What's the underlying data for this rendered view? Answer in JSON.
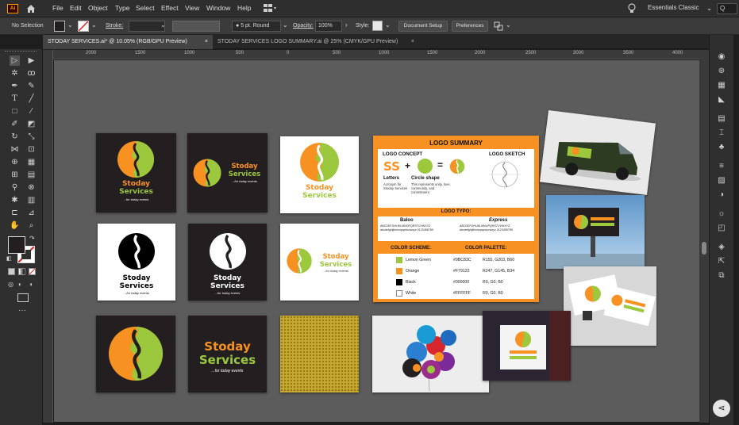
{
  "app": {
    "logo": "Ai",
    "workspace": "Essentials Classic",
    "search_hint": "Q"
  },
  "menu": [
    "File",
    "Edit",
    "Object",
    "Type",
    "Select",
    "Effect",
    "View",
    "Window",
    "Help"
  ],
  "control": {
    "selection": "No Selection",
    "stroke_label": "Stroke:",
    "brush": "5 pt. Round",
    "opacity_label": "Opacity:",
    "opacity_value": "100%",
    "style_label": "Style:",
    "document_setup": "Document Setup",
    "preferences": "Preferences"
  },
  "tabs": [
    {
      "label": "STODAY SERVICES.ai* @ 10.05% (RGB/GPU Preview)",
      "active": true,
      "close": "×"
    },
    {
      "label": "STODAY SERVICES LOGO SUMMARY.ai @ 25% (CMYK/GPU Preview)",
      "active": false,
      "close": "×"
    }
  ],
  "ruler": [
    "2000",
    "1500",
    "1000",
    "500",
    "0",
    "500",
    "1000",
    "1500",
    "2000",
    "2500",
    "3000",
    "3500",
    "4000"
  ],
  "colors": {
    "green": "#9BC83C",
    "orange": "#F79122",
    "black": "#231F20"
  },
  "logo": {
    "line1": "Stoday",
    "line2": "Services",
    "tagline": "...for today events"
  },
  "summary": {
    "title": "LOGO SUMMARY",
    "concept": "LOGO CONCEPT",
    "sketch": "LOGO SKETCH",
    "letters": "SS",
    "plus": "+",
    "equals": "=",
    "letters_label": "Letters",
    "letters_desc": "Acronym for Stoday Services",
    "circle_label": "Circle shape",
    "circle_desc": "This represents unity, love, community, and commitment",
    "typo": "LOGO TYPO:",
    "font1": "Baloo",
    "font2": "Express",
    "font1_sample": "ABCDEFGHIJKLMNOPQRSTUVWXYZ abcdefghijklmnopqrstuvwxyz 0123456789",
    "font2_sample": "ABCDEFGHIJKLMNOPQRSTUVWXYZ abcdefghijklmnopqrstuvwxyz 0123456789",
    "scheme": "COLOR SCHEME:",
    "palette": "COLOR PALETTE:",
    "rows": [
      {
        "name": "Lemon Green",
        "hex": "#9BC83C",
        "rgb": "R155, G203, B60",
        "swatch": "#9BC83C"
      },
      {
        "name": "Orange",
        "hex": "#F79122",
        "rgb": "R247, G145, B34",
        "swatch": "#F79122"
      },
      {
        "name": "Black",
        "hex": "#000000",
        "rgb": "R0, G0, B0",
        "swatch": "#000000"
      },
      {
        "name": "White",
        "hex": "#FFFFFF",
        "rgb": "R0, G0, B0",
        "swatch": "#FFFFFF"
      }
    ]
  }
}
